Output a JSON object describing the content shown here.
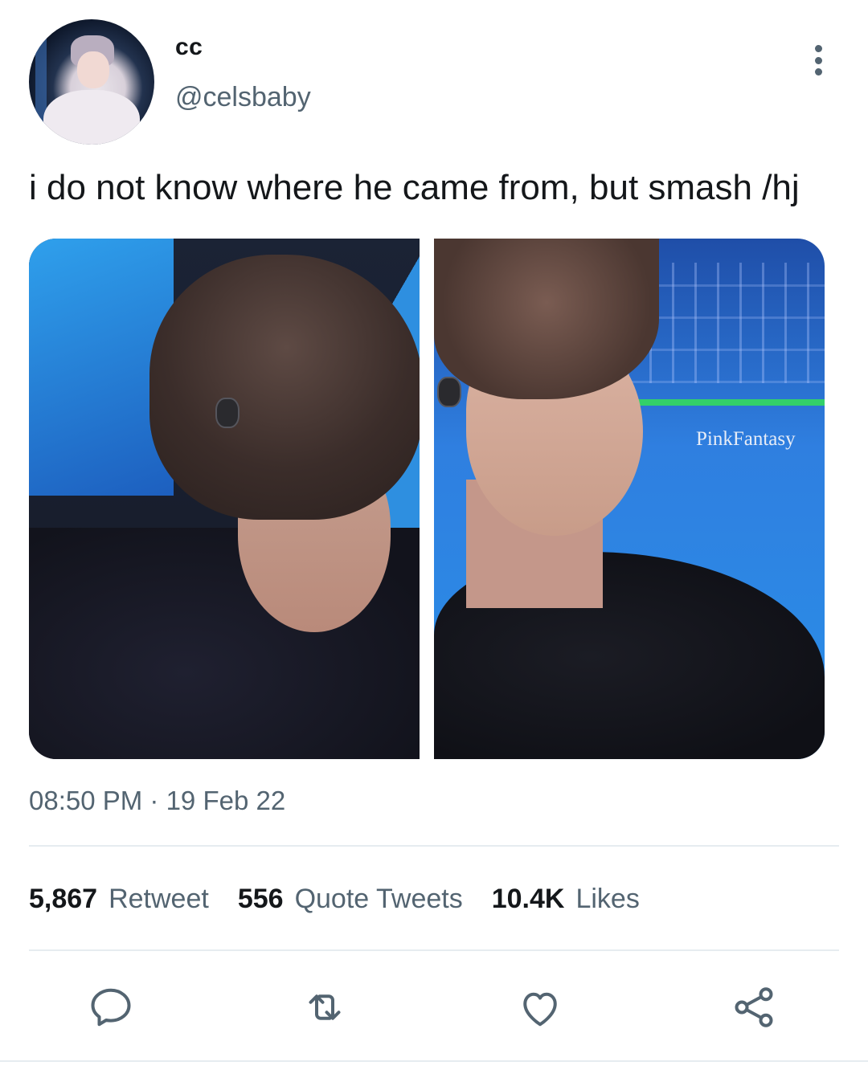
{
  "user": {
    "display_name": "cc",
    "handle": "@celsbaby"
  },
  "tweet": {
    "text": "i do not know where he came from, but smash /hj",
    "media": [
      {
        "alt": "photo-left",
        "watermark": ""
      },
      {
        "alt": "photo-right",
        "watermark": "PinkFantasy"
      }
    ],
    "timestamp": "08:50 PM · 19 Feb 22"
  },
  "stats": {
    "retweets": {
      "count": "5,867",
      "label": "Retweet"
    },
    "quotes": {
      "count": "556",
      "label": "Quote Tweets"
    },
    "likes": {
      "count": "10.4K",
      "label": "Likes"
    }
  },
  "actions": [
    {
      "name": "reply",
      "icon": "reply-icon"
    },
    {
      "name": "retweet",
      "icon": "retweet-icon"
    },
    {
      "name": "like",
      "icon": "heart-icon"
    },
    {
      "name": "share",
      "icon": "share-icon"
    }
  ],
  "colors": {
    "text_primary": "#14171a",
    "text_secondary": "#536471",
    "divider": "#e6ecf0"
  }
}
